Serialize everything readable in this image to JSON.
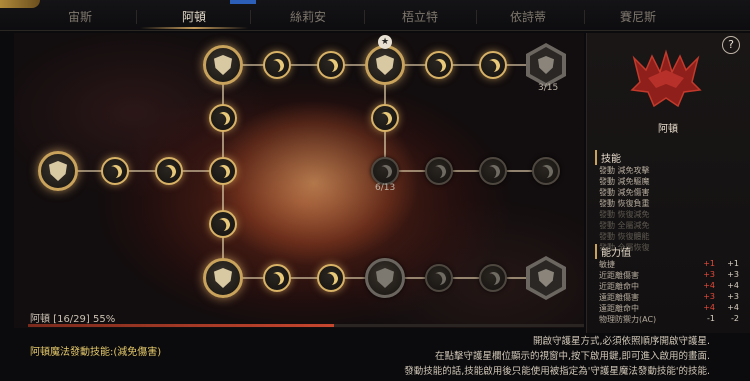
{
  "tabs": [
    {
      "label": "宙斯",
      "active": false
    },
    {
      "label": "阿頓",
      "active": true
    },
    {
      "label": "絲莉安",
      "active": false
    },
    {
      "label": "梧立特",
      "active": false
    },
    {
      "label": "依詩蒂",
      "active": false
    },
    {
      "label": "賽尼斯",
      "active": false
    }
  ],
  "tree": {
    "counter_top": "3/15",
    "counter_mid": "6/13"
  },
  "progress": {
    "label": "阿頓 [16/29] 55%",
    "value": 0.55
  },
  "panel": {
    "help": "?",
    "name": "阿頓",
    "skills_title": "技能",
    "skills": [
      {
        "text": "發動 減免攻擊",
        "active": true
      },
      {
        "text": "發動 減免驅魔",
        "active": true
      },
      {
        "text": "發動 減免傷害",
        "active": true
      },
      {
        "text": "發動 恢復負重",
        "active": true
      },
      {
        "text": "發動 恢復減免",
        "active": false
      },
      {
        "text": "發動 全屬減免",
        "active": false
      },
      {
        "text": "發動 恢復體能",
        "active": false
      },
      {
        "text": "發動 全屬恢復",
        "active": false
      }
    ],
    "stats_title": "能力值",
    "stats": [
      {
        "name": "敏捷",
        "a": "+1",
        "b": "+1"
      },
      {
        "name": "近距離傷害",
        "a": "+3",
        "b": "+3"
      },
      {
        "name": "近距離命中",
        "a": "+4",
        "b": "+4"
      },
      {
        "name": "遠距離傷害",
        "a": "+3",
        "b": "+3"
      },
      {
        "name": "遠距離命中",
        "a": "+4",
        "b": "+4"
      },
      {
        "name": "物理防禦力(AC)",
        "a": "-1",
        "b": "-2"
      }
    ]
  },
  "footer": {
    "left": "阿頓魔法發動技能:(減免傷害)",
    "right": [
      "開啟守護星方式,必須依照順序開啟守護星.",
      "在點擊守護星欄位顯示的視窗中,按下啟用鍵,即可進入啟用的畫面.",
      "發動技能的話,技能啟用後只能使用被指定為'守護星魔法發動技能'的技能."
    ]
  },
  "colors": {
    "accent": "#c9a35b",
    "stat_bonus": "#e34a3a",
    "progress": "#c7462e"
  }
}
